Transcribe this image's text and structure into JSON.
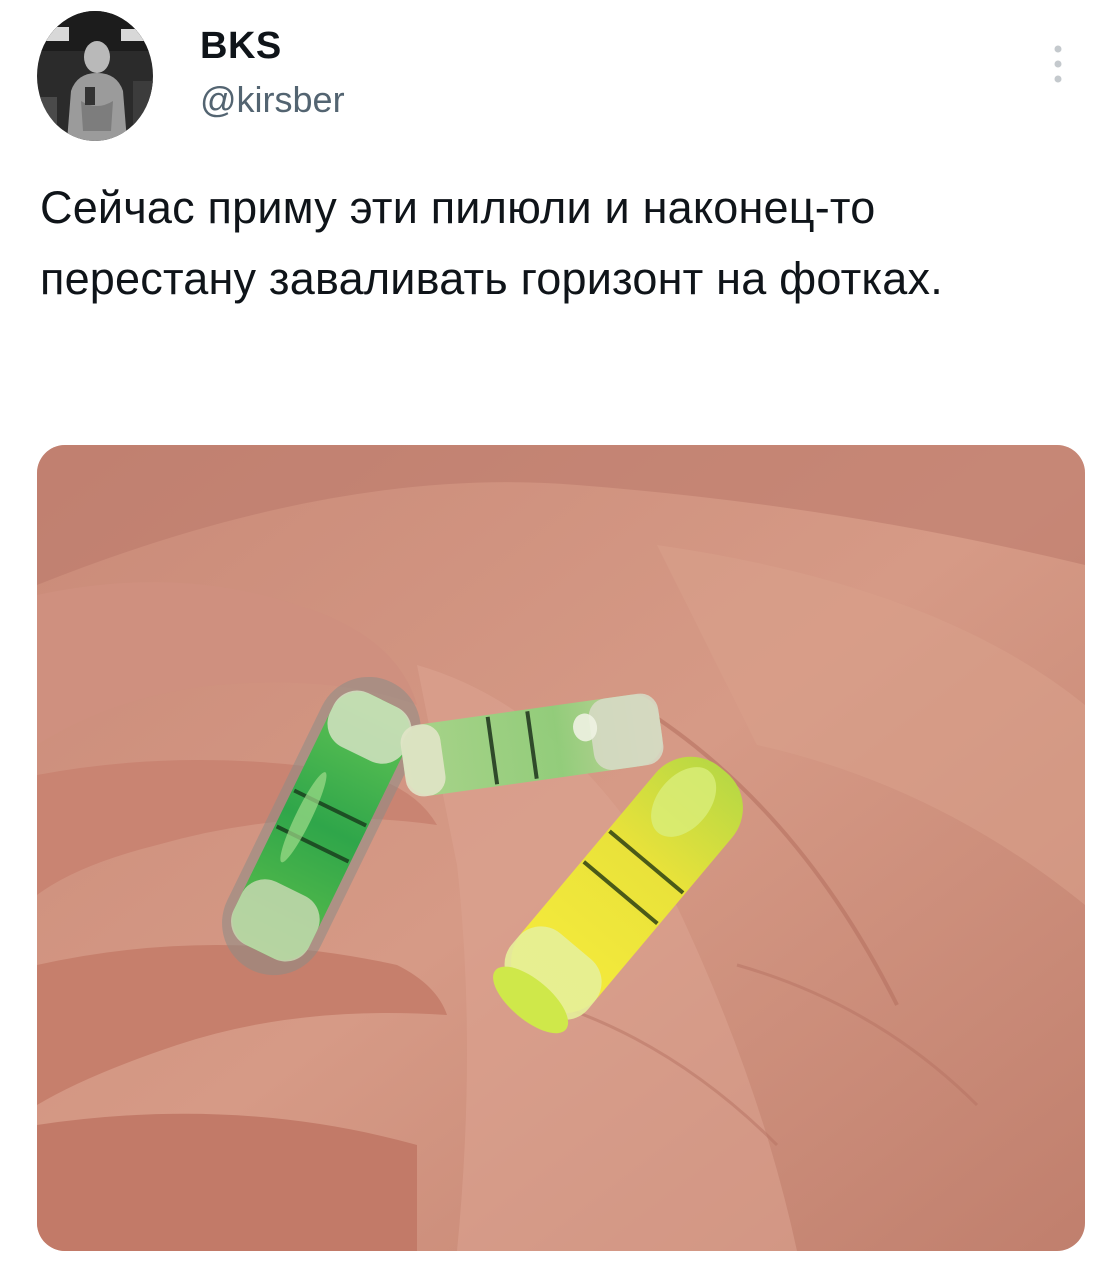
{
  "author": {
    "name": "BKS",
    "handle": "@kirsber",
    "avatar_icon": "person-avatar-icon"
  },
  "menu": {
    "icon": "more-vertical-icon"
  },
  "tweet": {
    "text": "Сейчас приму эти пилюли и наконец-то перестану заваливать горизонт на фотках."
  },
  "media": {
    "icon": "photo-hand-holding-spirit-level-vials"
  },
  "colors": {
    "text_primary": "#0f1419",
    "text_secondary": "#536471",
    "background": "#ffffff"
  }
}
